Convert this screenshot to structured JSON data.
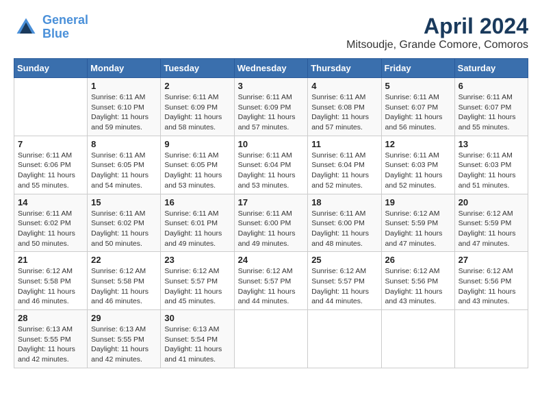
{
  "logo": {
    "line1": "General",
    "line2": "Blue"
  },
  "title": "April 2024",
  "location": "Mitsoudje, Grande Comore, Comoros",
  "weekdays": [
    "Sunday",
    "Monday",
    "Tuesday",
    "Wednesday",
    "Thursday",
    "Friday",
    "Saturday"
  ],
  "weeks": [
    [
      {
        "day": "",
        "sunrise": "",
        "sunset": "",
        "daylight": ""
      },
      {
        "day": "1",
        "sunrise": "Sunrise: 6:11 AM",
        "sunset": "Sunset: 6:10 PM",
        "daylight": "Daylight: 11 hours and 59 minutes."
      },
      {
        "day": "2",
        "sunrise": "Sunrise: 6:11 AM",
        "sunset": "Sunset: 6:09 PM",
        "daylight": "Daylight: 11 hours and 58 minutes."
      },
      {
        "day": "3",
        "sunrise": "Sunrise: 6:11 AM",
        "sunset": "Sunset: 6:09 PM",
        "daylight": "Daylight: 11 hours and 57 minutes."
      },
      {
        "day": "4",
        "sunrise": "Sunrise: 6:11 AM",
        "sunset": "Sunset: 6:08 PM",
        "daylight": "Daylight: 11 hours and 57 minutes."
      },
      {
        "day": "5",
        "sunrise": "Sunrise: 6:11 AM",
        "sunset": "Sunset: 6:07 PM",
        "daylight": "Daylight: 11 hours and 56 minutes."
      },
      {
        "day": "6",
        "sunrise": "Sunrise: 6:11 AM",
        "sunset": "Sunset: 6:07 PM",
        "daylight": "Daylight: 11 hours and 55 minutes."
      }
    ],
    [
      {
        "day": "7",
        "sunrise": "Sunrise: 6:11 AM",
        "sunset": "Sunset: 6:06 PM",
        "daylight": "Daylight: 11 hours and 55 minutes."
      },
      {
        "day": "8",
        "sunrise": "Sunrise: 6:11 AM",
        "sunset": "Sunset: 6:05 PM",
        "daylight": "Daylight: 11 hours and 54 minutes."
      },
      {
        "day": "9",
        "sunrise": "Sunrise: 6:11 AM",
        "sunset": "Sunset: 6:05 PM",
        "daylight": "Daylight: 11 hours and 53 minutes."
      },
      {
        "day": "10",
        "sunrise": "Sunrise: 6:11 AM",
        "sunset": "Sunset: 6:04 PM",
        "daylight": "Daylight: 11 hours and 53 minutes."
      },
      {
        "day": "11",
        "sunrise": "Sunrise: 6:11 AM",
        "sunset": "Sunset: 6:04 PM",
        "daylight": "Daylight: 11 hours and 52 minutes."
      },
      {
        "day": "12",
        "sunrise": "Sunrise: 6:11 AM",
        "sunset": "Sunset: 6:03 PM",
        "daylight": "Daylight: 11 hours and 52 minutes."
      },
      {
        "day": "13",
        "sunrise": "Sunrise: 6:11 AM",
        "sunset": "Sunset: 6:03 PM",
        "daylight": "Daylight: 11 hours and 51 minutes."
      }
    ],
    [
      {
        "day": "14",
        "sunrise": "Sunrise: 6:11 AM",
        "sunset": "Sunset: 6:02 PM",
        "daylight": "Daylight: 11 hours and 50 minutes."
      },
      {
        "day": "15",
        "sunrise": "Sunrise: 6:11 AM",
        "sunset": "Sunset: 6:02 PM",
        "daylight": "Daylight: 11 hours and 50 minutes."
      },
      {
        "day": "16",
        "sunrise": "Sunrise: 6:11 AM",
        "sunset": "Sunset: 6:01 PM",
        "daylight": "Daylight: 11 hours and 49 minutes."
      },
      {
        "day": "17",
        "sunrise": "Sunrise: 6:11 AM",
        "sunset": "Sunset: 6:00 PM",
        "daylight": "Daylight: 11 hours and 49 minutes."
      },
      {
        "day": "18",
        "sunrise": "Sunrise: 6:11 AM",
        "sunset": "Sunset: 6:00 PM",
        "daylight": "Daylight: 11 hours and 48 minutes."
      },
      {
        "day": "19",
        "sunrise": "Sunrise: 6:12 AM",
        "sunset": "Sunset: 5:59 PM",
        "daylight": "Daylight: 11 hours and 47 minutes."
      },
      {
        "day": "20",
        "sunrise": "Sunrise: 6:12 AM",
        "sunset": "Sunset: 5:59 PM",
        "daylight": "Daylight: 11 hours and 47 minutes."
      }
    ],
    [
      {
        "day": "21",
        "sunrise": "Sunrise: 6:12 AM",
        "sunset": "Sunset: 5:58 PM",
        "daylight": "Daylight: 11 hours and 46 minutes."
      },
      {
        "day": "22",
        "sunrise": "Sunrise: 6:12 AM",
        "sunset": "Sunset: 5:58 PM",
        "daylight": "Daylight: 11 hours and 46 minutes."
      },
      {
        "day": "23",
        "sunrise": "Sunrise: 6:12 AM",
        "sunset": "Sunset: 5:57 PM",
        "daylight": "Daylight: 11 hours and 45 minutes."
      },
      {
        "day": "24",
        "sunrise": "Sunrise: 6:12 AM",
        "sunset": "Sunset: 5:57 PM",
        "daylight": "Daylight: 11 hours and 44 minutes."
      },
      {
        "day": "25",
        "sunrise": "Sunrise: 6:12 AM",
        "sunset": "Sunset: 5:57 PM",
        "daylight": "Daylight: 11 hours and 44 minutes."
      },
      {
        "day": "26",
        "sunrise": "Sunrise: 6:12 AM",
        "sunset": "Sunset: 5:56 PM",
        "daylight": "Daylight: 11 hours and 43 minutes."
      },
      {
        "day": "27",
        "sunrise": "Sunrise: 6:12 AM",
        "sunset": "Sunset: 5:56 PM",
        "daylight": "Daylight: 11 hours and 43 minutes."
      }
    ],
    [
      {
        "day": "28",
        "sunrise": "Sunrise: 6:13 AM",
        "sunset": "Sunset: 5:55 PM",
        "daylight": "Daylight: 11 hours and 42 minutes."
      },
      {
        "day": "29",
        "sunrise": "Sunrise: 6:13 AM",
        "sunset": "Sunset: 5:55 PM",
        "daylight": "Daylight: 11 hours and 42 minutes."
      },
      {
        "day": "30",
        "sunrise": "Sunrise: 6:13 AM",
        "sunset": "Sunset: 5:54 PM",
        "daylight": "Daylight: 11 hours and 41 minutes."
      },
      {
        "day": "",
        "sunrise": "",
        "sunset": "",
        "daylight": ""
      },
      {
        "day": "",
        "sunrise": "",
        "sunset": "",
        "daylight": ""
      },
      {
        "day": "",
        "sunrise": "",
        "sunset": "",
        "daylight": ""
      },
      {
        "day": "",
        "sunrise": "",
        "sunset": "",
        "daylight": ""
      }
    ]
  ]
}
